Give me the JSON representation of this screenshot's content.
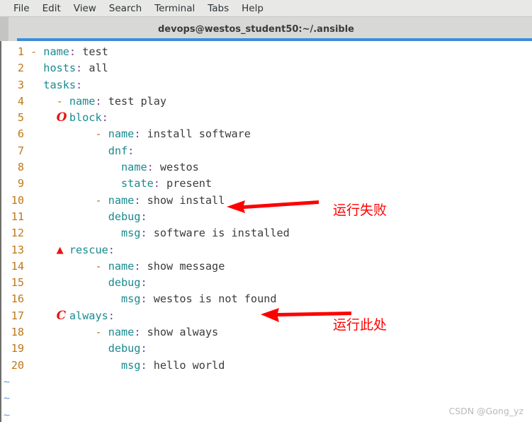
{
  "menubar": {
    "items": [
      {
        "label": "File"
      },
      {
        "label": "Edit"
      },
      {
        "label": "View"
      },
      {
        "label": "Search"
      },
      {
        "label": "Terminal"
      },
      {
        "label": "Tabs"
      },
      {
        "label": "Help"
      }
    ]
  },
  "tab": {
    "title": "devops@westos_student50:~/.ansible"
  },
  "colors": {
    "line_number": "#c07818",
    "key": "#1a8a8f",
    "colon": "#7b3fa0",
    "value": "#3b3b3b",
    "dash": "#c07818",
    "tilde": "#6b9fd4",
    "annotation": "#ff0000",
    "tab_underline": "#3c8ddc",
    "chrome": "#d8d8d6"
  },
  "editor": {
    "lines": [
      {
        "n": "1",
        "indent": 0,
        "dash": true,
        "key": "name",
        "value": "test",
        "mark": ""
      },
      {
        "n": "2",
        "indent": 1,
        "dash": false,
        "key": "hosts",
        "value": "all",
        "mark": ""
      },
      {
        "n": "3",
        "indent": 1,
        "dash": false,
        "key": "tasks",
        "value": "",
        "mark": ""
      },
      {
        "n": "4",
        "indent": 2,
        "dash": true,
        "key": "name",
        "value": "test play",
        "mark": ""
      },
      {
        "n": "5",
        "indent": 3,
        "dash": false,
        "key": "block",
        "value": "",
        "mark": "O"
      },
      {
        "n": "6",
        "indent": 5,
        "dash": true,
        "key": "name",
        "value": "install software",
        "mark": ""
      },
      {
        "n": "7",
        "indent": 6,
        "dash": false,
        "key": "dnf",
        "value": "",
        "mark": ""
      },
      {
        "n": "8",
        "indent": 7,
        "dash": false,
        "key": "name",
        "value": "westos",
        "mark": ""
      },
      {
        "n": "9",
        "indent": 7,
        "dash": false,
        "key": "state",
        "value": "present",
        "mark": ""
      },
      {
        "n": "10",
        "indent": 5,
        "dash": true,
        "key": "name",
        "value": "show install",
        "mark": ""
      },
      {
        "n": "11",
        "indent": 6,
        "dash": false,
        "key": "debug",
        "value": "",
        "mark": ""
      },
      {
        "n": "12",
        "indent": 7,
        "dash": false,
        "key": "msg",
        "value": "software is installed",
        "mark": ""
      },
      {
        "n": "13",
        "indent": 3,
        "dash": false,
        "key": "rescue",
        "value": "",
        "mark": "A"
      },
      {
        "n": "14",
        "indent": 5,
        "dash": true,
        "key": "name",
        "value": "show message",
        "mark": ""
      },
      {
        "n": "15",
        "indent": 6,
        "dash": false,
        "key": "debug",
        "value": "",
        "mark": ""
      },
      {
        "n": "16",
        "indent": 7,
        "dash": false,
        "key": "msg",
        "value": "westos is not found",
        "mark": ""
      },
      {
        "n": "17",
        "indent": 3,
        "dash": false,
        "key": "always",
        "value": "",
        "mark": "C"
      },
      {
        "n": "18",
        "indent": 5,
        "dash": true,
        "key": "name",
        "value": "show always",
        "mark": ""
      },
      {
        "n": "19",
        "indent": 6,
        "dash": false,
        "key": "debug",
        "value": "",
        "mark": ""
      },
      {
        "n": "20",
        "indent": 7,
        "dash": false,
        "key": "msg",
        "value": "hello world",
        "mark": ""
      }
    ],
    "empty_markers": [
      "~",
      "~",
      "~"
    ]
  },
  "annotations": [
    {
      "text": "运行失败",
      "target_line": "8"
    },
    {
      "text": "运行此处",
      "target_line": "14"
    }
  ],
  "watermark": {
    "text": "CSDN @Gong_yz"
  }
}
